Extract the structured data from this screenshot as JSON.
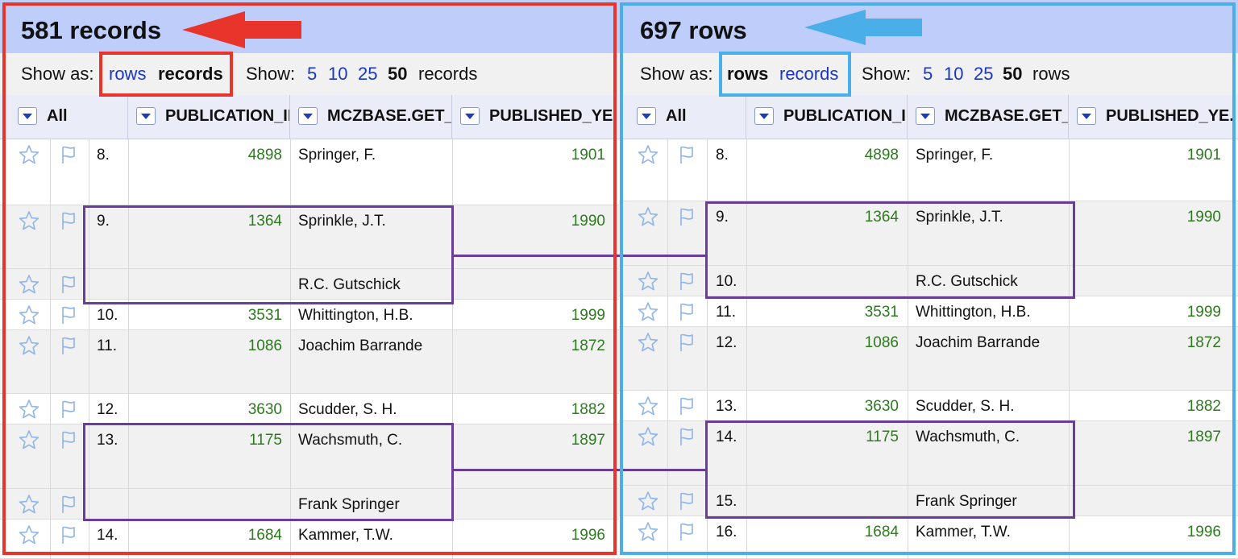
{
  "colors": {
    "left_frame": "#e8342a",
    "right_frame": "#4aaee8",
    "highlight": "#6a3d9a",
    "header_bg": "#bfcdfb",
    "number": "#2d7a1f",
    "link": "#1a35c9"
  },
  "left": {
    "title": "581 records",
    "show_as_label": "Show as:",
    "show_as_rows": "rows",
    "show_as_records": "records",
    "show_label": "Show:",
    "page_sizes": [
      "5",
      "10",
      "25",
      "50"
    ],
    "page_unit": "records",
    "columns": {
      "all": "All",
      "c1": "PUBLICATION_II",
      "c2": "MCZBASE.GET_",
      "c3": "PUBLISHED_YE."
    },
    "rows": [
      {
        "index": "8.",
        "id": "4898",
        "author": "Springer, F.",
        "year": "1901"
      },
      {
        "index": "9.",
        "id": "1364",
        "author": "Sprinkle, J.T.",
        "year": "1990"
      },
      {
        "index": "",
        "id": "",
        "author": "R.C. Gutschick",
        "year": ""
      },
      {
        "index": "10.",
        "id": "3531",
        "author": "Whittington, H.B.",
        "year": "1999"
      },
      {
        "index": "11.",
        "id": "1086",
        "author": "Joachim Barrande",
        "year": "1872"
      },
      {
        "index": "12.",
        "id": "3630",
        "author": "Scudder, S. H.",
        "year": "1882"
      },
      {
        "index": "13.",
        "id": "1175",
        "author": "Wachsmuth, C.",
        "year": "1897"
      },
      {
        "index": "",
        "id": "",
        "author": "Frank Springer",
        "year": ""
      },
      {
        "index": "14.",
        "id": "1684",
        "author": "Kammer, T.W.",
        "year": "1996"
      }
    ]
  },
  "right": {
    "title": "697 rows",
    "show_as_label": "Show as:",
    "show_as_rows": "rows",
    "show_as_records": "records",
    "show_label": "Show:",
    "page_sizes": [
      "5",
      "10",
      "25",
      "50"
    ],
    "page_unit": "rows",
    "columns": {
      "all": "All",
      "c1": "PUBLICATION_II",
      "c2": "MCZBASE.GET_",
      "c3": "PUBLISHED_YE."
    },
    "rows": [
      {
        "index": "8.",
        "id": "4898",
        "author": "Springer, F.",
        "year": "1901"
      },
      {
        "index": "9.",
        "id": "1364",
        "author": "Sprinkle, J.T.",
        "year": "1990"
      },
      {
        "index": "10.",
        "id": "",
        "author": "R.C. Gutschick",
        "year": ""
      },
      {
        "index": "11.",
        "id": "3531",
        "author": "Whittington, H.B.",
        "year": "1999"
      },
      {
        "index": "12.",
        "id": "1086",
        "author": "Joachim Barrande",
        "year": "1872"
      },
      {
        "index": "13.",
        "id": "3630",
        "author": "Scudder, S. H.",
        "year": "1882"
      },
      {
        "index": "14.",
        "id": "1175",
        "author": "Wachsmuth, C.",
        "year": "1897"
      },
      {
        "index": "15.",
        "id": "",
        "author": "Frank Springer",
        "year": ""
      },
      {
        "index": "16.",
        "id": "1684",
        "author": "Kammer, T.W.",
        "year": "1996"
      }
    ]
  }
}
